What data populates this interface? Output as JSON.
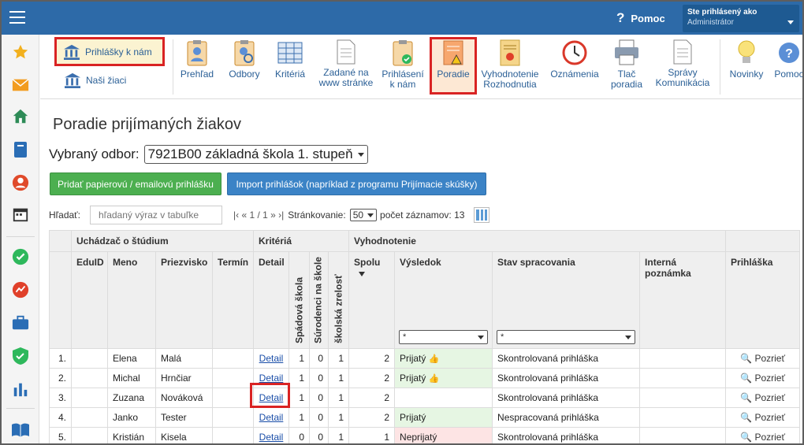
{
  "header": {
    "help_label": "Pomoc",
    "help_icon": "question-icon",
    "user_line1": "Ste prihlásený ako",
    "user_line2": "Administrátor"
  },
  "sidebar": {
    "icons": [
      "star-icon",
      "mail-icon",
      "home-icon",
      "book-icon",
      "user-icon",
      "calendar-icon",
      "check-icon",
      "chart-icon",
      "briefcase-icon",
      "shield-icon",
      "bar-chart-icon",
      "reading-icon"
    ]
  },
  "toolbar": {
    "prihlasky_label": "Prihlášky k nám",
    "ziaci_label": "Naši žiaci",
    "buttons": [
      {
        "line1": "Prehľad",
        "line2": ""
      },
      {
        "line1": "Odbory",
        "line2": ""
      },
      {
        "line1": "Kritériá",
        "line2": ""
      },
      {
        "line1": "Zadané na",
        "line2": "www stránke"
      },
      {
        "line1": "Prihlásení",
        "line2": "k nám"
      },
      {
        "line1": "Poradie",
        "line2": ""
      },
      {
        "line1": "Vyhodnotenie",
        "line2": "Rozhodnutia"
      },
      {
        "line1": "Oznámenia",
        "line2": ""
      },
      {
        "line1": "Tlač",
        "line2": "poradia"
      },
      {
        "line1": "Správy",
        "line2": "Komunikácia"
      },
      {
        "line1": "Novinky",
        "line2": ""
      },
      {
        "line1": "Pomoc",
        "line2": ""
      }
    ]
  },
  "page": {
    "title": "Poradie prijímaných žiakov",
    "odbor_label": "Vybraný odbor:",
    "odbor_value": "7921B00 základná škola 1. stupeň",
    "add_button": "Pridať papierovú / emailovú prihlášku",
    "import_button": "Import prihlášok (napríklad z programu Prijímacie skúšky)",
    "search_label": "Hľadať:",
    "search_placeholder": "hľadaný výraz v tabuľke",
    "pager": "|‹ « 1 / 1 » ›|",
    "page_size_label": "Stránkovanie:",
    "page_size": "50",
    "record_count": "počet záznamov: 13"
  },
  "table": {
    "groups": {
      "applicant": "Uchádzač o štúdium",
      "criteria": "Kritériá",
      "evaluation": "Vyhodnotenie"
    },
    "columns": {
      "eduid": "EduID",
      "meno": "Meno",
      "priezvisko": "Priezvisko",
      "termin": "Termín",
      "detail": "Detail",
      "spadova": "Spádová škola",
      "surodenci": "Súrodenci na škole",
      "zrelost": "školská zrelosť",
      "spolu": "Spolu",
      "vysledok": "Výsledok",
      "stav": "Stav spracovania",
      "poznamka": "Interná poznámka",
      "prihlaska": "Prihláška"
    },
    "filter_value": "*",
    "rows": [
      {
        "n": "1.",
        "meno": "Elena",
        "priezvisko": "Malá",
        "detail": "Detail",
        "a": "1",
        "b": "0",
        "c": "1",
        "spolu": "2",
        "vysledok": "Prijatý",
        "status": "ok",
        "thumb": true,
        "stav": "Skontrolovaná prihláška",
        "view": "Pozrieť"
      },
      {
        "n": "2.",
        "meno": "Michal",
        "priezvisko": "Hrnčiar",
        "detail": "Detail",
        "a": "1",
        "b": "0",
        "c": "1",
        "spolu": "2",
        "vysledok": "Prijatý",
        "status": "ok",
        "thumb": true,
        "stav": "Skontrolovaná prihláška",
        "view": "Pozrieť"
      },
      {
        "n": "3.",
        "meno": "Zuzana",
        "priezvisko": "Nováková",
        "detail": "Detail",
        "a": "1",
        "b": "0",
        "c": "1",
        "spolu": "2",
        "vysledok": "",
        "status": "",
        "thumb": false,
        "stav": "Skontrolovaná prihláška",
        "view": "Pozrieť"
      },
      {
        "n": "4.",
        "meno": "Janko",
        "priezvisko": "Tester",
        "detail": "Detail",
        "a": "1",
        "b": "0",
        "c": "1",
        "spolu": "2",
        "vysledok": "Prijatý",
        "status": "ok",
        "thumb": false,
        "stav": "Nespracovaná prihláška",
        "view": "Pozrieť"
      },
      {
        "n": "5.",
        "meno": "Kristián",
        "priezvisko": "Kisela",
        "detail": "Detail",
        "a": "0",
        "b": "0",
        "c": "1",
        "spolu": "1",
        "vysledok": "Neprijatý",
        "status": "no",
        "thumb": false,
        "stav": "Skontrolovaná prihláška",
        "view": "Pozrieť"
      }
    ]
  }
}
